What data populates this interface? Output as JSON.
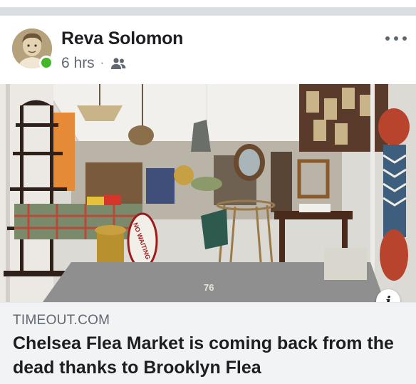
{
  "post": {
    "author": "Reva Solomon",
    "time": "6 hrs",
    "separator": "·",
    "audience_icon": "friends-icon",
    "online_color": "#42b72a",
    "more_icon": "more-options-icon"
  },
  "link": {
    "domain": "TIMEOUT.COM",
    "title": "Chelsea Flea Market is coming back from the dead thanks to Brooklyn Flea",
    "info_icon": "info-icon",
    "info_glyph": "i"
  },
  "photo": {
    "description_icon": "flea-market-photo",
    "sign_text": "NO WAITING",
    "floor_number": "76"
  },
  "colors": {
    "divider": "#dadde1",
    "link_box": "#f2f3f5",
    "primary_text": "#1c1e21",
    "secondary_text": "#606770"
  }
}
